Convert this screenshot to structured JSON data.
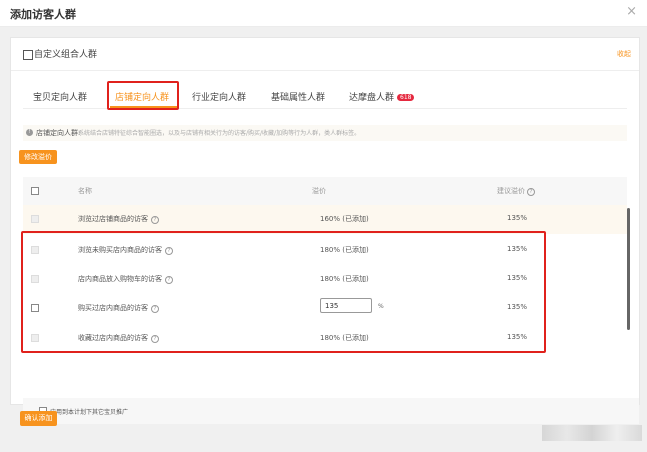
{
  "dialog": {
    "title": "添加访客人群",
    "close": "×"
  },
  "panel": {
    "title": "自定义组合人群",
    "link": "收起"
  },
  "tabs": [
    {
      "label": "宝贝定向人群",
      "active": false
    },
    {
      "label": "店铺定向人群",
      "active": true
    },
    {
      "label": "行业定向人群",
      "active": false
    },
    {
      "label": "基础属性人群",
      "active": false
    },
    {
      "label": "达摩盘人群",
      "active": false,
      "badge": "618"
    }
  ],
  "notice": {
    "label": "店铺定向人群:",
    "text": "系统结合店铺特征综合智能圈选，以及与店铺有相关行为的访客/购买/收藏/加购等行为人群，类人群标签。"
  },
  "edit_button": "修改溢价",
  "table": {
    "headers": {
      "name": "名称",
      "premium": "溢价",
      "suggested": "建议溢价"
    },
    "rows": [
      {
        "name": "浏览过店铺商品的访客",
        "premium": "160% (已添加)",
        "suggested": "135%",
        "checked_disabled": true,
        "editable": false
      },
      {
        "name": "浏览未购买店内商品的访客",
        "premium": "180% (已添加)",
        "suggested": "135%",
        "checked_disabled": true,
        "editable": false
      },
      {
        "name": "店内商品放入购物车的访客",
        "premium": "180% (已添加)",
        "suggested": "135%",
        "checked_disabled": true,
        "editable": false
      },
      {
        "name": "购买过店内商品的访客",
        "premium": "135",
        "premium_unit": "%",
        "suggested": "135%",
        "checked_disabled": false,
        "editable": true
      },
      {
        "name": "收藏过店内商品的访客",
        "premium": "180% (已添加)",
        "suggested": "135%",
        "checked_disabled": true,
        "editable": false
      }
    ]
  },
  "bottom_option": "应用到本计划下其它宝贝推广",
  "confirm_button": "确认添加",
  "colors": {
    "accent": "#f7931e",
    "highlight_box": "#e0211c",
    "badge": "#e5293f"
  }
}
